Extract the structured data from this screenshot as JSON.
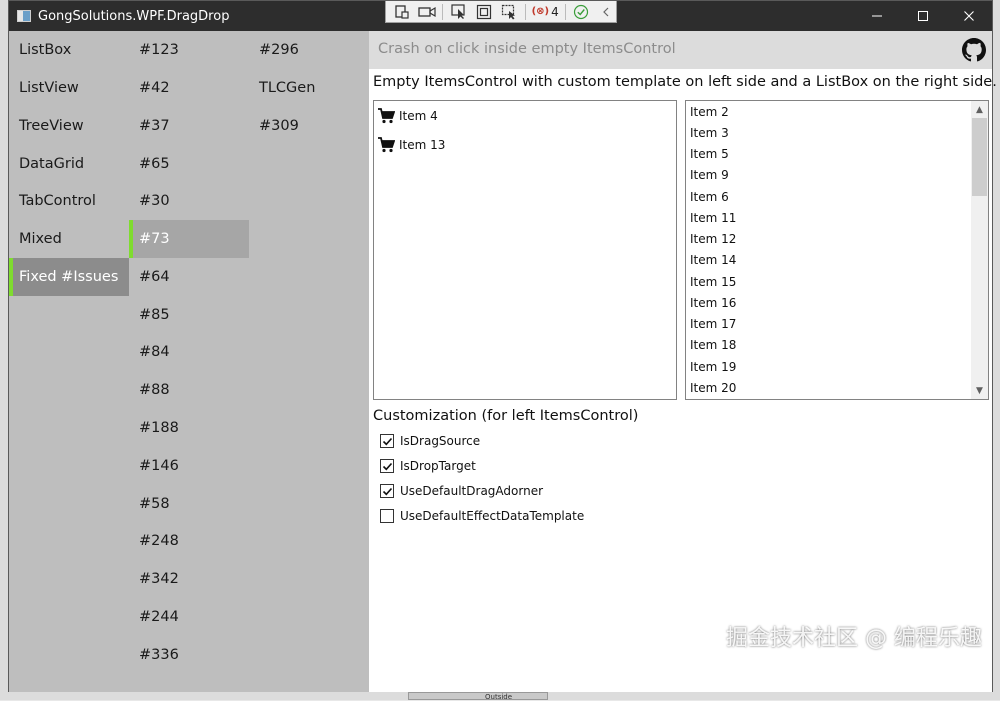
{
  "window": {
    "title": "GongSolutions.WPF.DragDrop"
  },
  "debug_toolbar": {
    "error_count": "4"
  },
  "nav_categories": [
    {
      "label": "ListBox"
    },
    {
      "label": "ListView"
    },
    {
      "label": "TreeView"
    },
    {
      "label": "DataGrid"
    },
    {
      "label": "TabControl"
    },
    {
      "label": "Mixed"
    },
    {
      "label": "Fixed #Issues"
    }
  ],
  "issues_col1": [
    {
      "label": "#123"
    },
    {
      "label": "#42"
    },
    {
      "label": "#37"
    },
    {
      "label": "#65"
    },
    {
      "label": "#30"
    },
    {
      "label": "#73"
    },
    {
      "label": "#64"
    },
    {
      "label": "#85"
    },
    {
      "label": "#84"
    },
    {
      "label": "#88"
    },
    {
      "label": "#188"
    },
    {
      "label": "#146"
    },
    {
      "label": "#58"
    },
    {
      "label": "#248"
    },
    {
      "label": "#342"
    },
    {
      "label": "#244"
    },
    {
      "label": "#336"
    }
  ],
  "issues_col2": [
    {
      "label": "#296"
    },
    {
      "label": "TLCGen"
    },
    {
      "label": "#309"
    }
  ],
  "content": {
    "header_title": "Crash on click inside empty ItemsControl",
    "description": "Empty ItemsControl with custom template on left side and a ListBox on the right side.",
    "left_items": [
      {
        "label": "Item 4"
      },
      {
        "label": "Item 13"
      }
    ],
    "right_items": [
      {
        "label": "Item 2"
      },
      {
        "label": "Item 3"
      },
      {
        "label": "Item 5"
      },
      {
        "label": "Item 9"
      },
      {
        "label": "Item 6"
      },
      {
        "label": "Item 11"
      },
      {
        "label": "Item 12"
      },
      {
        "label": "Item 14"
      },
      {
        "label": "Item 15"
      },
      {
        "label": "Item 16"
      },
      {
        "label": "Item 17"
      },
      {
        "label": "Item 18"
      },
      {
        "label": "Item 19"
      },
      {
        "label": "Item 20"
      }
    ],
    "customization_title": "Customization (for left ItemsControl)",
    "options": [
      {
        "label": "IsDragSource",
        "checked": true
      },
      {
        "label": "IsDropTarget",
        "checked": true
      },
      {
        "label": "UseDefaultDragAdorner",
        "checked": true
      },
      {
        "label": "UseDefaultEffectDataTemplate",
        "checked": false
      }
    ]
  },
  "watermark": "掘金技术社区 @ 编程乐趣",
  "taskbar": {
    "label": "Outside"
  },
  "colors": {
    "nav_bg": "#bebebe",
    "selected_bg": "#8c8c8c",
    "accent": "#7fdc2f",
    "titlebar": "#2d2d2d"
  }
}
